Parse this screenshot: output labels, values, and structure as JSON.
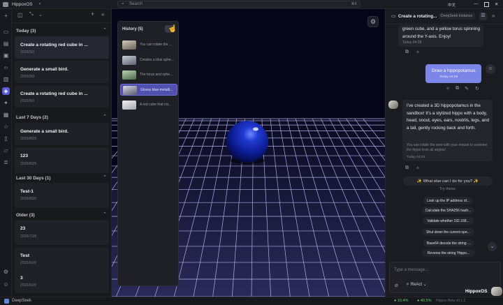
{
  "app": {
    "title": "HippoxOS",
    "search_placeholder": "Search",
    "search_shortcut": "⌘K",
    "lang": "中文"
  },
  "rail_icons": [
    "plus-icon",
    "chat-icon",
    "film-icon",
    "image-icon",
    "code-icon",
    "book-icon",
    "cube-icon",
    "puzzle-icon",
    "package-icon",
    "star-icon",
    "document-icon",
    "folder-icon",
    "list-icon"
  ],
  "sidebar": {
    "groups": [
      {
        "label": "Today (3)",
        "items": [
          {
            "title": "Create a rotating red cube in ...",
            "date": "2026/9/3",
            "selected": true
          },
          {
            "title": "Generate a small bird.",
            "date": "2026/9/3",
            "selected": false
          },
          {
            "title": "Create a rotating red cube in ...",
            "date": "2026/9/3",
            "selected": false
          }
        ]
      },
      {
        "label": "Last 7 Days (2)",
        "items": [
          {
            "title": "Generate a small bird.",
            "date": "2026/8/29",
            "selected": false
          },
          {
            "title": "123",
            "date": "2026/8/29",
            "selected": false
          }
        ]
      },
      {
        "label": "Last 30 Days (1)",
        "items": [
          {
            "title": "Test-1",
            "date": "2026/8/20",
            "selected": false
          }
        ]
      },
      {
        "label": "Older (3)",
        "items": [
          {
            "title": "23",
            "date": "2026/7/28",
            "selected": false
          },
          {
            "title": "Test",
            "date": "2026/6/20",
            "selected": false
          },
          {
            "title": "3",
            "date": "2026/6/20",
            "selected": false
          }
        ]
      }
    ]
  },
  "history": {
    "title": "History (5)",
    "items": [
      {
        "text": "You can rotate the ...",
        "color": "#9a8f80"
      },
      {
        "text": "Creates a blue sphe...",
        "color": "#7f8a99"
      },
      {
        "text": "The torus and sphe...",
        "color": "#6f8f6f"
      },
      {
        "text": "Glossy blue metalli...",
        "color": "#7c7f8f"
      },
      {
        "text": "A red cube that rot...",
        "color": "#b0b0b8"
      }
    ]
  },
  "chat": {
    "header_title": "Create a rotating...",
    "model_badge": "DeepSeek Instance",
    "msg1_text": "green cube, and a yellow torus spinning around the Y-axis. Enjoy!",
    "msg1_time": "Today 04:28",
    "user_msg": "Draw a hippopotamus.",
    "user_time": "Today 04:29",
    "assistant_msg": "I've created a 3D hippopotamus in the sandbox! It's a stylized hippo with a body, head, snout, eyes, ears, nostrils, legs, and a tail, gently rocking back and forth.",
    "assistant_note": "You can rotate the view with your mouse to examine the hippo from all angles!",
    "assistant_time": "Today 04:29",
    "prompt_bar": "✨ What else can I do for you? ✨",
    "try_these": "Try these:",
    "suggestions": [
      "Look up the IP address of...",
      "Calculate the SHA256 hash...",
      "Validate whether 192.168...",
      "Shut down the current ope...",
      "Base64 decode the string ...",
      "Reverse the string 'Hippo..."
    ],
    "input_placeholder": "Type a message...",
    "mode_label": "ReAct"
  },
  "status": {
    "engine": "DeepSeek",
    "cpu": "10.4%",
    "mem": "40.5%",
    "version_text": "Hippox Beta v0.1.2",
    "logo_text": "HippoxOS"
  },
  "colors": {
    "accent": "#5b5bd6",
    "user_bubble": "#7b86e8",
    "grid": "#c8c8ff",
    "sphere": "#0a1fa8"
  }
}
